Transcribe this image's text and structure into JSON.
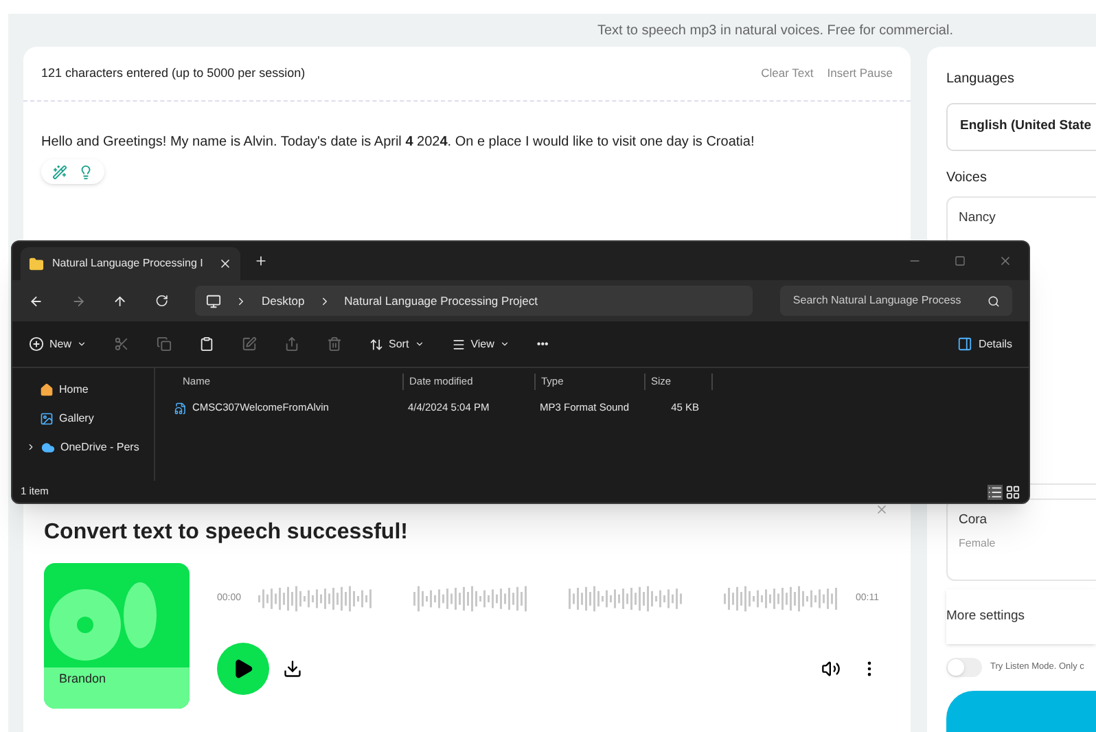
{
  "tagline": "Text to speech mp3 in natural voices. Free for commercial.",
  "editor": {
    "char_count": "121 characters entered (up to 5000 per session)",
    "actions": [
      "Clear Text",
      "Insert Pause"
    ],
    "text": "Hello and Greetings! My name is Alvin. Today's date is April **4** 202**4**. On e place I would like to visit one day is Croatia!"
  },
  "result": {
    "title": "Convert text to speech successful!",
    "voice_name": "Brandon",
    "time_start": "00:00",
    "time_end": "00:11"
  },
  "settings": {
    "languages_label": "Languages",
    "language": "English (United State",
    "voices_label": "Voices",
    "voices": [
      {
        "name": "Nancy",
        "selected": false
      },
      {
        "name": "Cora",
        "gender": "Female",
        "selected": false
      }
    ],
    "more_settings": "More settings",
    "listen_mode": {
      "label": "Try Listen Mode. Only c",
      "on": false
    }
  },
  "explorer": {
    "tab_title": "Natural Language Processing I",
    "breadcrumb": [
      "Desktop",
      "Natural Language Processing Project"
    ],
    "search_placeholder": "Search Natural Language Process",
    "toolbar": [
      {
        "kind": "new",
        "label": "New"
      },
      {
        "kind": "cut"
      },
      {
        "kind": "copy"
      },
      {
        "kind": "paste"
      },
      {
        "kind": "rename"
      },
      {
        "kind": "share"
      },
      {
        "kind": "delete"
      },
      {
        "kind": "sort",
        "label": "Sort"
      },
      {
        "kind": "view",
        "label": "View"
      },
      {
        "kind": "more",
        "label": "•••"
      }
    ],
    "details": "Details",
    "nav": [
      {
        "label": "Home",
        "kind": "home",
        "selected": false
      },
      {
        "label": "Gallery",
        "kind": "gallery",
        "selected": false
      },
      {
        "label": "OneDrive - Pers",
        "kind": "cloud",
        "selected": false
      }
    ],
    "columns": [
      "Name",
      "Date modified",
      "Type",
      "Size"
    ],
    "files": [
      {
        "name": "CMSC307WelcomeFromAlvin",
        "date": "4/4/2024 5:04 PM",
        "type": "MP3 Format Sound",
        "size": "45 KB",
        "selected": false
      }
    ],
    "status": "1 item"
  }
}
